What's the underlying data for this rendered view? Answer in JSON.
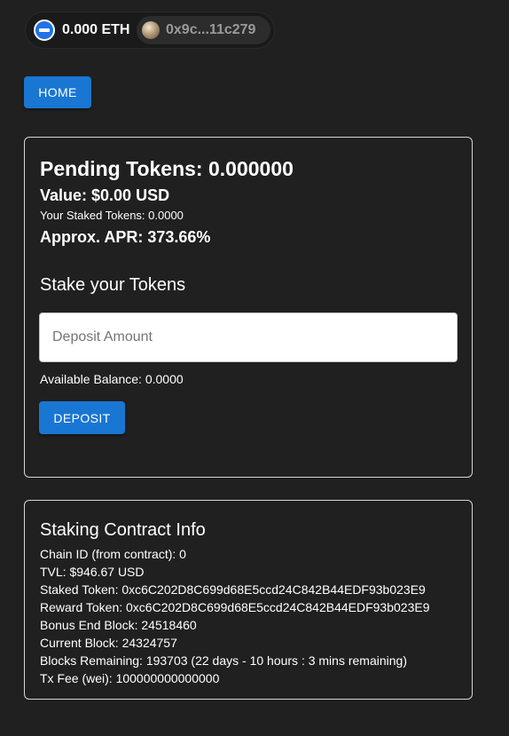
{
  "wallet": {
    "eth_balance": "0.000 ETH",
    "address": "0x9c...11c279"
  },
  "nav": {
    "home_label": "HOME"
  },
  "stake_card": {
    "pending_tokens": "Pending Tokens: 0.000000",
    "value": "Value: $0.00 USD",
    "staked_tokens": "Your Staked Tokens: 0.0000",
    "apr": "Approx. APR: 373.66%",
    "heading": "Stake your Tokens",
    "deposit_placeholder": "Deposit Amount",
    "available_balance": "Available Balance: 0.0000",
    "deposit_label": "DEPOSIT"
  },
  "info_card": {
    "heading": "Staking Contract Info",
    "lines": [
      "Chain ID (from contract): 0",
      "TVL: $946.67 USD",
      "Staked Token: 0xc6C202D8C699d68E5ccd24C842B44EDF93b023E9",
      "Reward Token: 0xc6C202D8C699d68E5ccd24C842B44EDF93b023E9",
      "Bonus End Block: 24518460",
      "Current Block: 24324757",
      "Blocks Remaining: 193703 (22 days - 10 hours : 3 mins remaining)",
      "Tx Fee (wei): 100000000000000"
    ]
  },
  "colors": {
    "background": "#202020",
    "primary": "#1976d2",
    "card_border": "#d5d5d5"
  },
  "icons": {
    "eth": "ethereum-icon",
    "account": "avatar"
  }
}
